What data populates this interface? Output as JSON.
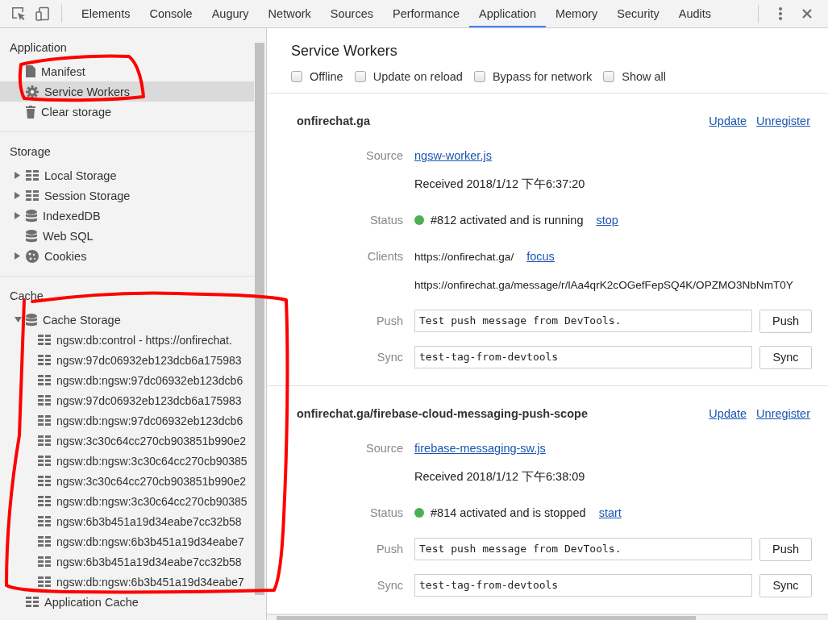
{
  "toolbar": {
    "tabs": [
      {
        "label": "Elements",
        "selected": false
      },
      {
        "label": "Console",
        "selected": false
      },
      {
        "label": "Augury",
        "selected": false
      },
      {
        "label": "Network",
        "selected": false
      },
      {
        "label": "Sources",
        "selected": false
      },
      {
        "label": "Performance",
        "selected": false
      },
      {
        "label": "Application",
        "selected": true
      },
      {
        "label": "Memory",
        "selected": false
      },
      {
        "label": "Security",
        "selected": false
      },
      {
        "label": "Audits",
        "selected": false
      }
    ]
  },
  "sidebar": {
    "sections": [
      {
        "title": "Application",
        "items": [
          {
            "label": "Manifest",
            "kind": "document",
            "selected": false
          },
          {
            "label": "Service Workers",
            "kind": "gear",
            "selected": true
          },
          {
            "label": "Clear storage",
            "kind": "trash",
            "selected": false
          }
        ]
      },
      {
        "title": "Storage",
        "items": [
          {
            "label": "Local Storage",
            "kind": "grid",
            "selected": false,
            "expanded": false
          },
          {
            "label": "Session Storage",
            "kind": "grid",
            "selected": false,
            "expanded": false
          },
          {
            "label": "IndexedDB",
            "kind": "database",
            "selected": false,
            "expanded": false
          },
          {
            "label": "Web SQL",
            "kind": "database",
            "selected": false
          },
          {
            "label": "Cookies",
            "kind": "cookie",
            "selected": false,
            "expanded": false
          }
        ]
      },
      {
        "title": "Cache",
        "items": [
          {
            "label": "Cache Storage",
            "kind": "database",
            "selected": false,
            "expanded": true,
            "children": [
              {
                "label": "ngsw:db:control - https://onfirechat.",
                "kind": "grid",
                "selected": false
              },
              {
                "label": "ngsw:97dc06932eb123dcb6a175983",
                "kind": "grid",
                "selected": false
              },
              {
                "label": "ngsw:db:ngsw:97dc06932eb123dcb6",
                "kind": "grid",
                "selected": false
              },
              {
                "label": "ngsw:97dc06932eb123dcb6a175983",
                "kind": "grid",
                "selected": false
              },
              {
                "label": "ngsw:db:ngsw:97dc06932eb123dcb6",
                "kind": "grid",
                "selected": false
              },
              {
                "label": "ngsw:3c30c64cc270cb903851b990e2",
                "kind": "grid",
                "selected": false
              },
              {
                "label": "ngsw:db:ngsw:3c30c64cc270cb90385",
                "kind": "grid",
                "selected": false
              },
              {
                "label": "ngsw:3c30c64cc270cb903851b990e2",
                "kind": "grid",
                "selected": false
              },
              {
                "label": "ngsw:db:ngsw:3c30c64cc270cb90385",
                "kind": "grid",
                "selected": false
              },
              {
                "label": "ngsw:6b3b451a19d34eabe7cc32b58",
                "kind": "grid",
                "selected": false
              },
              {
                "label": "ngsw:db:ngsw:6b3b451a19d34eabe7",
                "kind": "grid",
                "selected": false
              },
              {
                "label": "ngsw:6b3b451a19d34eabe7cc32b58",
                "kind": "grid",
                "selected": false
              },
              {
                "label": "ngsw:db:ngsw:6b3b451a19d34eabe7",
                "kind": "grid",
                "selected": false
              }
            ]
          },
          {
            "label": "Application Cache",
            "kind": "grid",
            "selected": false
          }
        ]
      }
    ]
  },
  "panel": {
    "title": "Service Workers",
    "options": [
      {
        "label": "Offline",
        "checked": false
      },
      {
        "label": "Update on reload",
        "checked": false
      },
      {
        "label": "Bypass for network",
        "checked": false
      },
      {
        "label": "Show all",
        "checked": false
      }
    ],
    "workers": [
      {
        "scope": "onfirechat.ga",
        "actions": [
          "Update",
          "Unregister"
        ],
        "source_label": "Source",
        "source": "ngsw-worker.js",
        "received": "Received 2018/1/12 下午6:37:20",
        "status_label": "Status",
        "status": {
          "color": "#4caf50",
          "text": "#812 activated and is running",
          "action": "stop"
        },
        "clients_label": "Clients",
        "clients": [
          {
            "url": "https://onfirechat.ga/",
            "action": "focus"
          },
          {
            "url": "https://onfirechat.ga/message/r/lAa4qrK2cOGefFepSQ4K/OPZMO3NbNmT0Y"
          }
        ],
        "push": {
          "label": "Push",
          "value": "Test push message from DevTools.",
          "button": "Push"
        },
        "sync": {
          "label": "Sync",
          "value": "test-tag-from-devtools",
          "button": "Sync"
        }
      },
      {
        "scope": "onfirechat.ga/firebase-cloud-messaging-push-scope",
        "actions": [
          "Update",
          "Unregister"
        ],
        "source_label": "Source",
        "source": "firebase-messaging-sw.js",
        "received": "Received 2018/1/12 下午6:38:09",
        "status_label": "Status",
        "status": {
          "color": "#4caf50",
          "text": "#814 activated and is stopped",
          "action": "start"
        },
        "push": {
          "label": "Push",
          "value": "Test push message from DevTools.",
          "button": "Push"
        },
        "sync": {
          "label": "Sync",
          "value": "test-tag-from-devtools",
          "button": "Sync"
        }
      }
    ]
  }
}
